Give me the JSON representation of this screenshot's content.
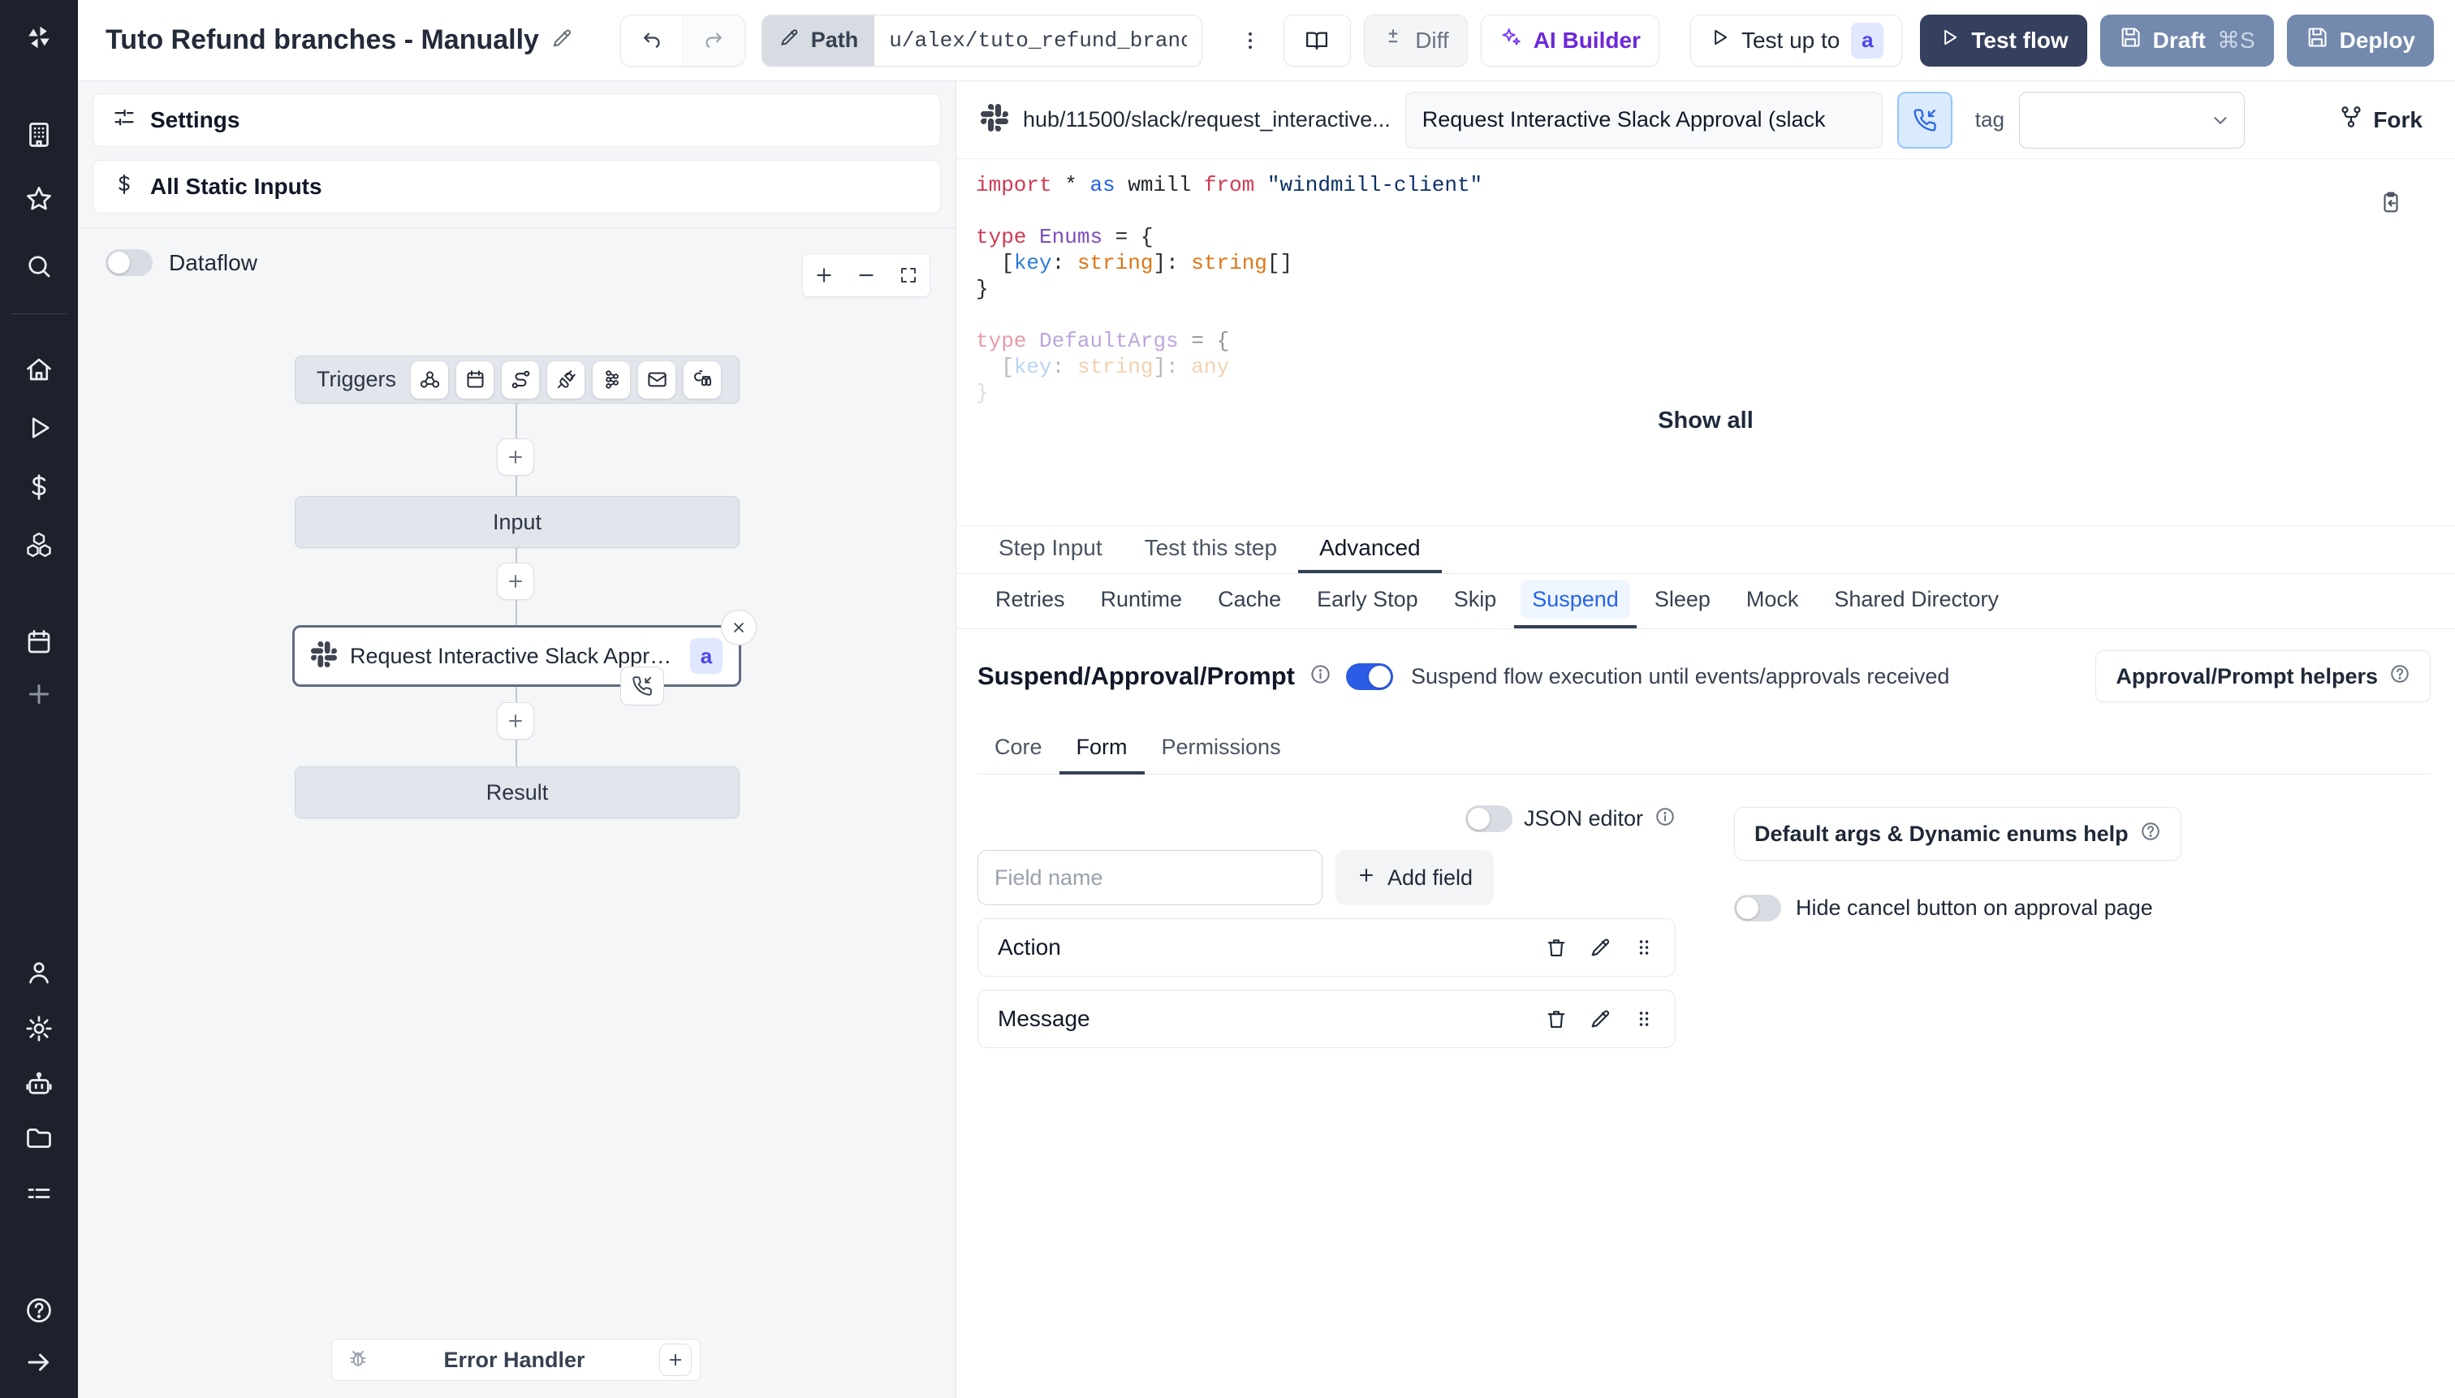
{
  "colors": {
    "accent_blue": "#2563eb",
    "toggle_on": "#2c5ce5",
    "badge_bg": "#e0e7ff",
    "badge_text": "#4f46e5",
    "test_flow_bg": "#353f5e",
    "draft_deploy_bg": "#7389ad",
    "ai_builder_purple": "#6d28d9",
    "sidebar_bg": "#1d212b"
  },
  "topbar": {
    "title": "Tuto Refund branches - Manually",
    "path_label": "Path",
    "path_value": "u/alex/tuto_refund_branches__",
    "diff_label": "Diff",
    "ai_builder_label": "AI Builder",
    "test_up_to_label": "Test up to",
    "test_up_to_badge": "a",
    "test_flow_label": "Test flow",
    "draft_label": "Draft",
    "draft_shortcut": "⌘S",
    "deploy_label": "Deploy"
  },
  "flow_panel": {
    "settings_label": "Settings",
    "all_static_inputs_label": "All Static Inputs",
    "dataflow_label": "Dataflow",
    "graph": {
      "triggers_label": "Triggers",
      "input_label": "Input",
      "step_label": "Request Interactive Slack Approval (...",
      "step_badge": "a",
      "result_label": "Result",
      "error_handler_label": "Error Handler"
    }
  },
  "right_panel": {
    "header": {
      "script_path": "hub/11500/slack/request_interactive...",
      "step_name": "Request Interactive Slack Approval (slack",
      "tag_label": "tag",
      "fork_label": "Fork"
    },
    "editor": {
      "show_all_label": "Show all",
      "lines": [
        {
          "tk": [
            {
              "t": "import",
              "c": "kw"
            },
            {
              "t": " * ",
              "c": "pl"
            },
            {
              "t": "as",
              "c": "kw2"
            },
            {
              "t": " wmill ",
              "c": "pl"
            },
            {
              "t": "from",
              "c": "kw"
            },
            {
              "t": " ",
              "c": "pl"
            },
            {
              "t": "\"windmill-client\"",
              "c": "str"
            }
          ]
        },
        {
          "tk": []
        },
        {
          "tk": [
            {
              "t": "type",
              "c": "kw"
            },
            {
              "t": " ",
              "c": "pl"
            },
            {
              "t": "Enums",
              "c": "typ"
            },
            {
              "t": " = {",
              "c": "pl"
            }
          ]
        },
        {
          "tk": [
            {
              "t": "  [",
              "c": "pl"
            },
            {
              "t": "key",
              "c": "prop"
            },
            {
              "t": ": ",
              "c": "pl"
            },
            {
              "t": "string",
              "c": "bi"
            },
            {
              "t": "]: ",
              "c": "pl"
            },
            {
              "t": "string",
              "c": "bi"
            },
            {
              "t": "[]",
              "c": "pl"
            }
          ]
        },
        {
          "tk": [
            {
              "t": "}",
              "c": "pl"
            }
          ]
        },
        {
          "tk": []
        },
        {
          "o": 0.5,
          "tk": [
            {
              "t": "type",
              "c": "kw"
            },
            {
              "t": " ",
              "c": "pl"
            },
            {
              "t": "DefaultArgs",
              "c": "typ"
            },
            {
              "t": " = {",
              "c": "pl"
            }
          ]
        },
        {
          "o": 0.33,
          "tk": [
            {
              "t": "  [",
              "c": "pl"
            },
            {
              "t": "key",
              "c": "prop"
            },
            {
              "t": ": ",
              "c": "pl"
            },
            {
              "t": "string",
              "c": "bi"
            },
            {
              "t": "]: ",
              "c": "pl"
            },
            {
              "t": "any",
              "c": "bi"
            }
          ]
        },
        {
          "o": 0.15,
          "tk": [
            {
              "t": "}",
              "c": "pl"
            }
          ]
        }
      ]
    },
    "tabs": {
      "items": [
        "Step Input",
        "Test this step",
        "Advanced"
      ],
      "active": "Advanced"
    },
    "advanced_tabs": {
      "items": [
        "Retries",
        "Runtime",
        "Cache",
        "Early Stop",
        "Skip",
        "Suspend",
        "Sleep",
        "Mock",
        "Shared Directory"
      ],
      "active": "Suspend"
    },
    "suspend": {
      "title": "Suspend/Approval/Prompt",
      "toggle_description": "Suspend flow execution until events/approvals received",
      "helpers_label": "Approval/Prompt helpers",
      "tabs": {
        "items": [
          "Core",
          "Form",
          "Permissions"
        ],
        "active": "Form"
      },
      "form": {
        "json_editor_label": "JSON editor",
        "field_name_placeholder": "Field name",
        "add_field_label": "Add field",
        "fields": [
          "Action",
          "Message"
        ],
        "default_args_help_label": "Default args & Dynamic enums help",
        "hide_cancel_label": "Hide cancel button on approval page"
      }
    }
  }
}
